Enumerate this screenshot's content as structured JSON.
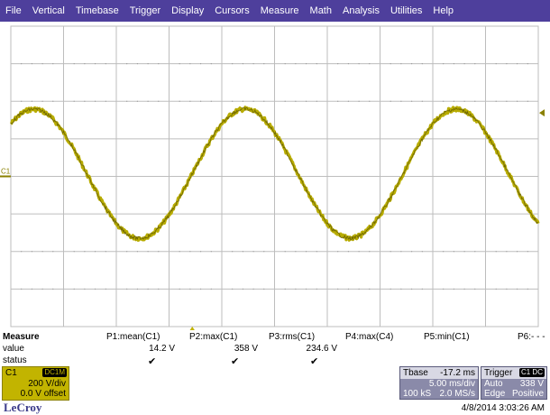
{
  "menu": [
    "File",
    "Vertical",
    "Timebase",
    "Trigger",
    "Display",
    "Cursors",
    "Measure",
    "Math",
    "Analysis",
    "Utilities",
    "Help"
  ],
  "colors": {
    "menubar": "#4e3f9c",
    "trace": "#b8ac00",
    "grid": "#bdbdbd",
    "channel_box": "#c2b400",
    "param_box": "#8a8aa9"
  },
  "display": {
    "channel_label": "C1",
    "icons": [
      "trigger-position-marker-icon",
      "trigger-level-marker-icon",
      "channel-offset-marker-icon"
    ]
  },
  "chart_data": {
    "type": "line",
    "grid_divisions": [
      10,
      8
    ],
    "x_unit": "ms",
    "x_per_div": 5.0,
    "y_unit": "V",
    "y_per_div": 200,
    "series": [
      {
        "amplitude": 358,
        "offset": 14.2,
        "period_ms": 20,
        "x_start_ms": -17.2,
        "x_end_ms": 32.8
      }
    ]
  },
  "measure": {
    "header": "Measure",
    "row_labels": [
      "value",
      "status"
    ],
    "params": [
      {
        "name": "P1:mean(C1)",
        "value": "14.2 V",
        "status": "✔"
      },
      {
        "name": "P2:max(C1)",
        "value": "358 V",
        "status": "✔"
      },
      {
        "name": "P3:rms(C1)",
        "value": "234.6 V",
        "status": "✔"
      },
      {
        "name": "P4:max(C4)",
        "value": "",
        "status": ""
      },
      {
        "name": "P5:min(C1)",
        "value": "",
        "status": ""
      },
      {
        "name": "P6:- - -",
        "value": "",
        "status": ""
      }
    ]
  },
  "channel": {
    "label": "C1",
    "coupling": "DC1M",
    "scale": "200 V/div",
    "offset": "0.0 V offset"
  },
  "timebase": {
    "title": "Tbase",
    "delay": "-17.2 ms",
    "scale": "5.00 ms/div",
    "samples": "100 kS",
    "rate": "2.0 MS/s"
  },
  "trigger": {
    "title": "Trigger",
    "badge": "C1 DC",
    "mode": "Auto",
    "level": "338 V",
    "type": "Edge",
    "slope": "Positive"
  },
  "footer": {
    "logo": "LeCroy",
    "timestamp": "4/8/2014 3:03:26 AM"
  }
}
